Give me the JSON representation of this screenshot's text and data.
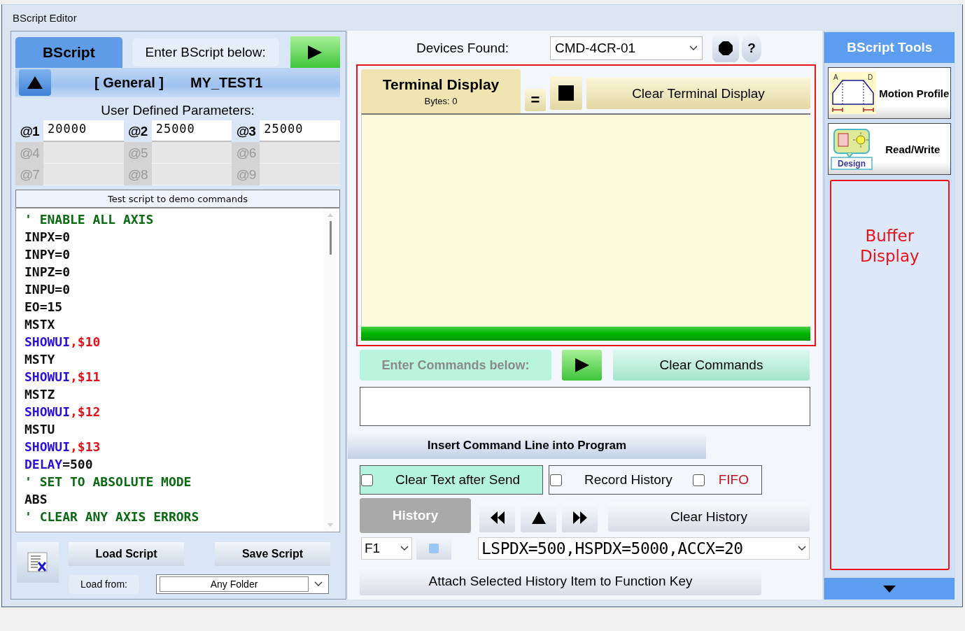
{
  "window": {
    "title": "BScript Editor"
  },
  "script_panel": {
    "tab": {
      "label": "BScript",
      "selected": true
    },
    "prompt": "Enter BScript below:",
    "section": "[ General ]",
    "script_name": "MY_TEST1",
    "params_title": "User Defined Parameters:",
    "params": [
      {
        "label": "@1",
        "value": "20000",
        "enabled": true
      },
      {
        "label": "@2",
        "value": "25000",
        "enabled": true
      },
      {
        "label": "@3",
        "value": "25000",
        "enabled": true
      },
      {
        "label": "@4",
        "enabled": false
      },
      {
        "label": "@5",
        "enabled": false
      },
      {
        "label": "@6",
        "enabled": false
      },
      {
        "label": "@7",
        "enabled": false
      },
      {
        "label": "@8",
        "enabled": false
      },
      {
        "label": "@9",
        "enabled": false
      }
    ],
    "editor_title": "Test script to demo commands",
    "lines": [
      [
        {
          "text": "' ENABLE ALL AXIS",
          "kind": "comment"
        }
      ],
      [
        {
          "text": "INPX=0",
          "kind": "plain"
        }
      ],
      [
        {
          "text": "INPY=0",
          "kind": "plain"
        }
      ],
      [
        {
          "text": "INPZ=0",
          "kind": "plain"
        }
      ],
      [
        {
          "text": "INPU=0",
          "kind": "plain"
        }
      ],
      [
        {
          "text": "EO=15",
          "kind": "plain"
        }
      ],
      [
        {
          "text": "MSTX",
          "kind": "plain"
        }
      ],
      [
        {
          "text": "SHOWUI",
          "kind": "command"
        },
        {
          "text": ",$10",
          "kind": "argument"
        }
      ],
      [
        {
          "text": "MSTY",
          "kind": "plain"
        }
      ],
      [
        {
          "text": "SHOWUI",
          "kind": "command"
        },
        {
          "text": ",$11",
          "kind": "argument"
        }
      ],
      [
        {
          "text": "MSTZ",
          "kind": "plain"
        }
      ],
      [
        {
          "text": "SHOWUI",
          "kind": "command"
        },
        {
          "text": ",$12",
          "kind": "argument"
        }
      ],
      [
        {
          "text": "MSTU",
          "kind": "plain"
        }
      ],
      [
        {
          "text": "SHOWUI",
          "kind": "command"
        },
        {
          "text": ",$13",
          "kind": "argument"
        }
      ],
      [
        {
          "text": "DELAY",
          "kind": "command"
        },
        {
          "text": "=500",
          "kind": "plain"
        }
      ],
      [
        {
          "text": "' SET TO ABSOLUTE MODE",
          "kind": "comment"
        }
      ],
      [
        {
          "text": "ABS",
          "kind": "plain"
        }
      ],
      [
        {
          "text": "' CLEAR ANY AXIS ERRORS",
          "kind": "comment"
        }
      ]
    ],
    "load_button": "Load Script",
    "save_button": "Save Script",
    "load_from": {
      "label": "Load from:",
      "value": "Any Folder"
    }
  },
  "devices": {
    "label": "Devices Found:",
    "value": "CMD-4CR-01",
    "help_button": "?"
  },
  "terminal": {
    "title": "Terminal Display",
    "bytes": "Bytes: 0",
    "equal_button": "=",
    "clear_button": "Clear Terminal Display"
  },
  "commands": {
    "label": "Enter Commands below:",
    "clear_button": "Clear Commands",
    "insert_button": "Insert Command Line into Program",
    "option_groups": [
      [
        {
          "label": "Clear Text after Send",
          "checked": false,
          "color": "#000000"
        }
      ],
      [
        {
          "label": "Record History",
          "checked": false,
          "color": "#000000"
        },
        {
          "label": "FIFO",
          "checked": false,
          "color": "#c0141c"
        }
      ]
    ],
    "history_button": "History",
    "clear_history_button": "Clear History",
    "function_key": "F1",
    "history_value": "LSPDX=500,HSPDX=5000,ACCX=20",
    "attach_button": "Attach Selected History Item to Function Key"
  },
  "tools": {
    "title": "BScript Tools",
    "items": [
      {
        "kind": "motion",
        "label": "Motion Profile",
        "icon_texts": [
          "A",
          "D"
        ]
      },
      {
        "kind": "readwrite",
        "label": "Read/Write",
        "icon_texts": [
          "Design"
        ]
      }
    ],
    "buffer_label": "Buffer Display"
  }
}
